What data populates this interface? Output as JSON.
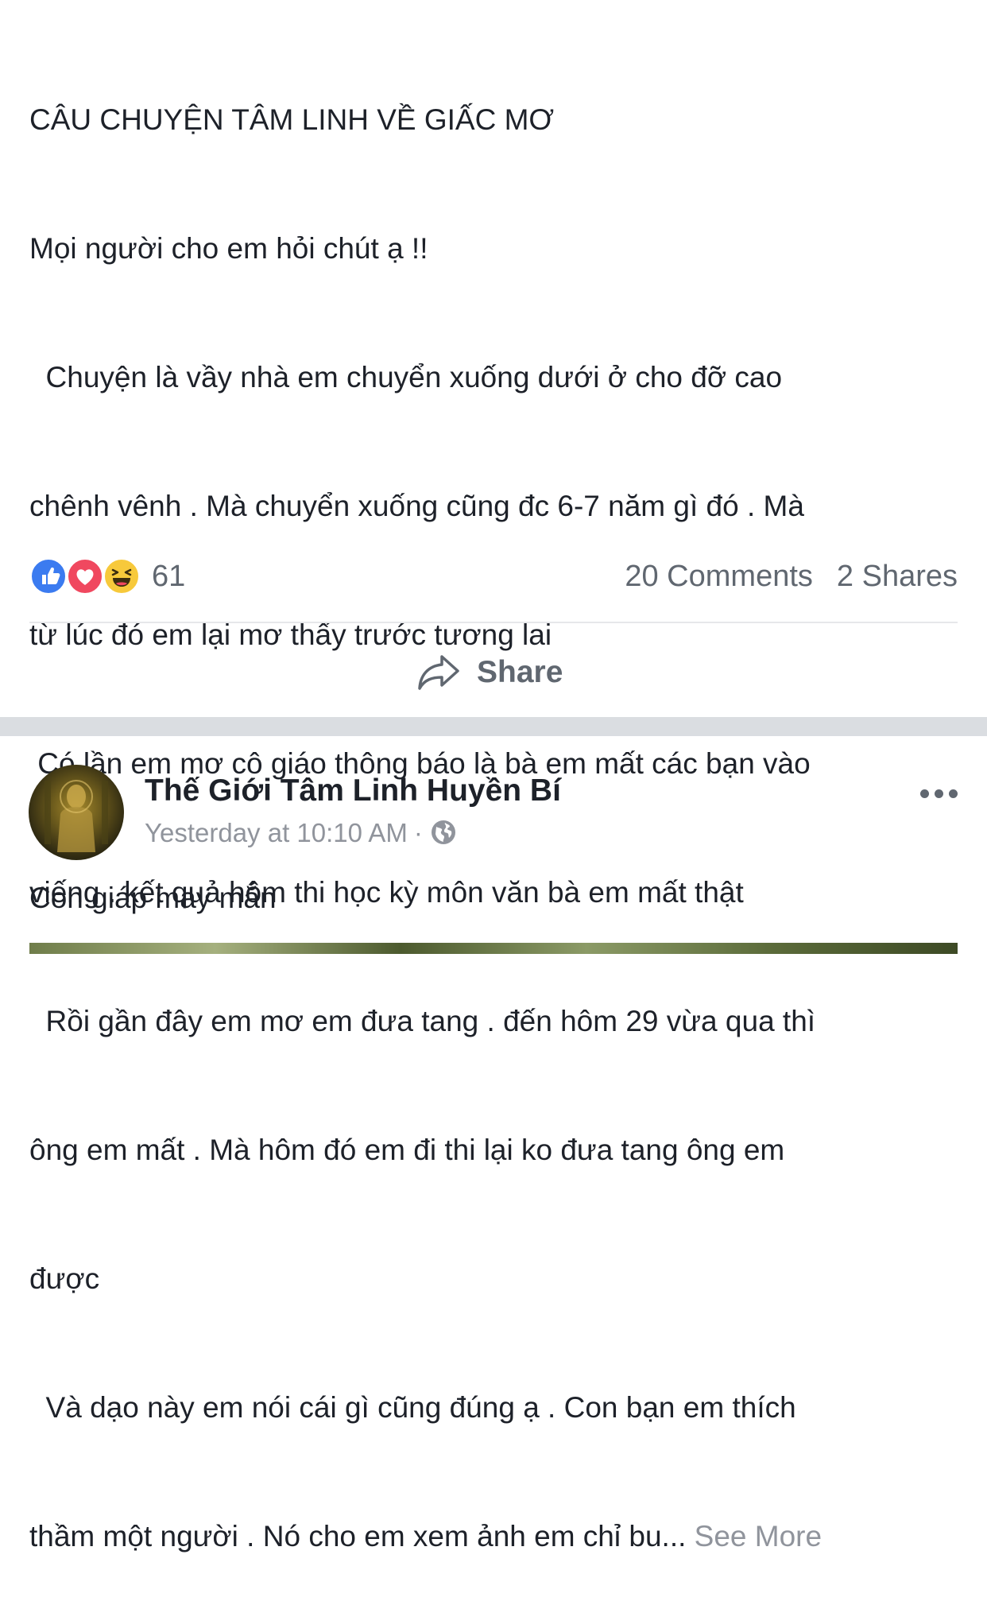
{
  "post1": {
    "lines": [
      "CÂU CHUYỆN TÂM LINH VỀ GIẤC MƠ",
      "Mọi người cho em hỏi chút ạ !!",
      "  Chuyện là vầy nhà em chuyển xuống dưới ở cho đỡ cao",
      "chênh vênh . Mà chuyển xuống cũng đc 6-7 năm gì đó . Mà",
      "từ lúc đó em lại mơ thấy trước tương lai",
      " Có lần em mơ cô giáo thông báo là bà em mất các bạn vào",
      "viếng . kết quả hôm thi học kỳ môn văn bà em mất thật",
      "  Rồi gần đây em mơ em đưa tang . đến hôm 29 vừa qua thì",
      "ông em mất . Mà hôm đó em đi thi lại ko đưa tang ông em",
      "được",
      "  Và dạo này em nói cái gì cũng đúng ạ . Con bạn em thích"
    ],
    "last_line": "thầm một người . Nó cho em xem ảnh em chỉ bu...",
    "see_more": "See More",
    "reactions": {
      "icons": [
        "like-icon",
        "love-icon",
        "haha-icon"
      ],
      "count": "61",
      "comments": "20 Comments",
      "shares": "2 Shares"
    },
    "share_label": "Share"
  },
  "post2": {
    "page_name": "Thế Giới Tâm Linh Huyền Bí",
    "timestamp": "Yesterday at 10:10 AM",
    "separator": "·",
    "privacy_icon": "globe-icon",
    "text": "Con giáp may mắn"
  },
  "colors": {
    "like": "#3b7bf0",
    "love": "#f0485f",
    "haha": "#f7c93b",
    "secondary_text": "#606770",
    "muted_text": "#90949c",
    "separator": "#dadde1"
  }
}
